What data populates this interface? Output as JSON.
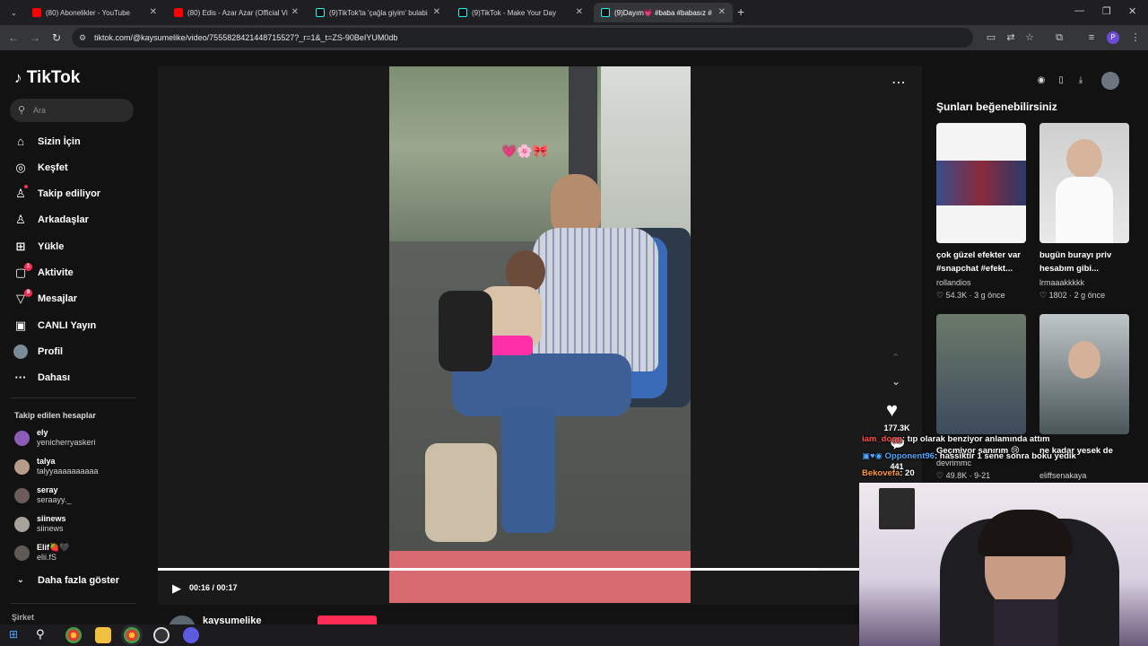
{
  "browser": {
    "tabs": [
      {
        "title": "(80) Abonelikler - YouTube",
        "icon": "youtube-icon"
      },
      {
        "title": "(80) Edis - Azar Azar (Official Vi",
        "icon": "youtube-icon"
      },
      {
        "title": "(9)TikTok'ta 'çağla giyim' bulabi",
        "icon": "tiktok-icon"
      },
      {
        "title": "(9)TikTok - Make Your Day",
        "icon": "tiktok-icon"
      },
      {
        "title": "(9)Dayım💗 #baba #babasız #",
        "icon": "tiktok-icon",
        "active": true
      }
    ],
    "url": "tiktok.com/@kaysumelike/video/7555828421448715527?_r=1&_t=ZS-90BeIYUM0db",
    "profile_letter": "P"
  },
  "sidebar": {
    "logo": "TikTok",
    "search_placeholder": "Ara",
    "nav": [
      {
        "label": "Sizin İçin",
        "icon": "home-icon",
        "glyph": "⌂"
      },
      {
        "label": "Keşfet",
        "icon": "compass-icon",
        "glyph": "◎"
      },
      {
        "label": "Takip ediliyor",
        "icon": "following-icon",
        "glyph": "👤"
      },
      {
        "label": "Arkadaşlar",
        "icon": "friends-icon",
        "glyph": "👥"
      },
      {
        "label": "Yükle",
        "icon": "upload-icon",
        "glyph": "⊞"
      },
      {
        "label": "Aktivite",
        "icon": "activity-icon",
        "glyph": "▢",
        "badge": "1"
      },
      {
        "label": "Mesajlar",
        "icon": "messages-icon",
        "glyph": "▽",
        "badge": "8"
      },
      {
        "label": "CANLI Yayın",
        "icon": "live-icon",
        "glyph": "▣"
      },
      {
        "label": "Profil",
        "icon": "profile-avatar",
        "glyph": ""
      },
      {
        "label": "Dahası",
        "icon": "more-icon",
        "glyph": "···"
      }
    ],
    "following_header": "Takip edilen hesaplar",
    "following": [
      {
        "name": "ely",
        "handle": "yenicherryaskeri"
      },
      {
        "name": "talya",
        "handle": "talyyaaaaaaaaaa"
      },
      {
        "name": "seray",
        "handle": "serаayy._"
      },
      {
        "name": "siinews",
        "handle": "siinews"
      },
      {
        "name": "Elif🍓🖤",
        "handle": "elii.fS"
      }
    ],
    "show_more": "Daha fazla göster",
    "footer": "Şirket"
  },
  "player": {
    "time": "00:16 / 00:17",
    "progress_fraction": 0.94,
    "likes": "177.3K",
    "comments": "441",
    "author": "kaysumelike",
    "video_sticker": "💗🌸🎀"
  },
  "recommend": {
    "title": "Şunları beğenebilirsiniz",
    "cards": [
      {
        "caption": "çok güzel efekter var #snapchat #efekt...",
        "user": "rollandios",
        "likes": "54.3K",
        "age": "3 g önce"
      },
      {
        "caption": "bugün burayı priv hesabım gibi...",
        "user": "lrmaaakkkkk",
        "likes": "1802",
        "age": "2 g önce"
      },
      {
        "caption": "Geçmiyor sanırım 😢",
        "user": "devrimmc",
        "likes": "49.8K",
        "age": "9-21"
      },
      {
        "caption": "ne kadar yesek de",
        "user": "eliffsenakaya",
        "likes": "",
        "age": ""
      }
    ]
  },
  "stream_chat": [
    {
      "user": "iam_dogg",
      "text": ": tıp olarak benziyor anlamında attım",
      "color": "#ff4d4d"
    },
    {
      "user": "Opponent96",
      "text": ": hassiktir 1 sene sonra boku yedik",
      "color": "#4da6ff"
    },
    {
      "user": "Bekovefa",
      "text": ": 20",
      "color": "#ff9a3d"
    }
  ]
}
